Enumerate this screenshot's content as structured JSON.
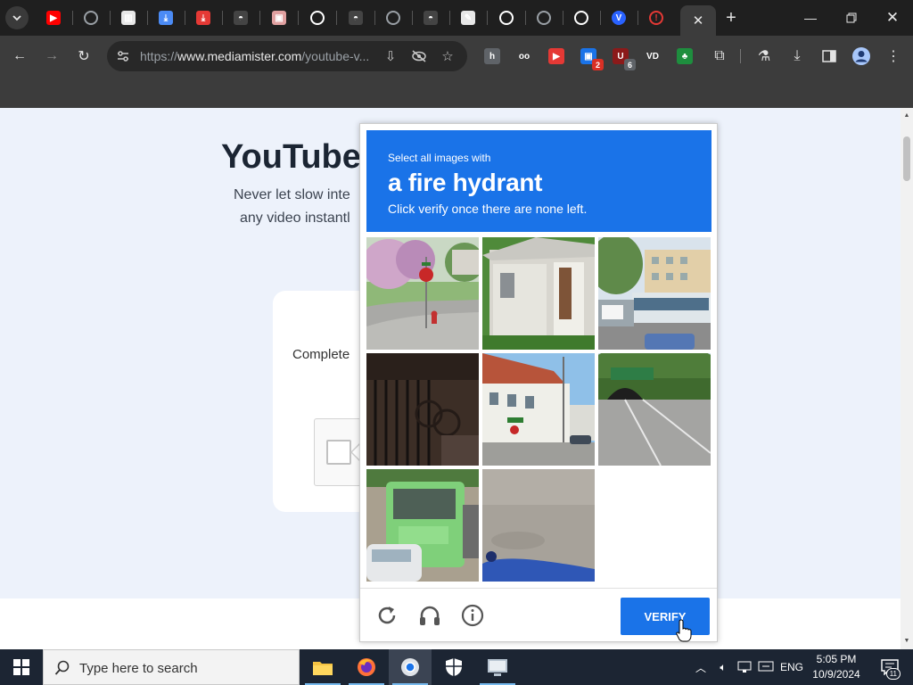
{
  "browser": {
    "tabs": [
      {
        "icon": "youtube-icon",
        "color": "#ff0000"
      },
      {
        "icon": "globe-icon",
        "color": "#9aa0a6"
      },
      {
        "icon": "bank-icon",
        "color": "#e8e8e8"
      },
      {
        "icon": "download-icon",
        "color": "#4b8bf5"
      },
      {
        "icon": "download-red-icon",
        "color": "#e53935"
      },
      {
        "icon": "incognito-icon",
        "color": "#444"
      },
      {
        "icon": "image-icon",
        "color": "#e0a0a0"
      },
      {
        "icon": "globe-icon",
        "color": "#ffffff"
      },
      {
        "icon": "incognito-icon",
        "color": "#444"
      },
      {
        "icon": "globe-icon",
        "color": "#9aa0a6"
      },
      {
        "icon": "incognito-icon",
        "color": "#444"
      },
      {
        "icon": "wrench-icon",
        "color": "#e8e8e8"
      },
      {
        "icon": "globe-icon",
        "color": "#ffffff"
      },
      {
        "icon": "globe-icon",
        "color": "#9aa0a6"
      },
      {
        "icon": "globe-icon",
        "color": "#ffffff"
      },
      {
        "icon": "vd-icon",
        "color": "#2962ff"
      },
      {
        "icon": "warning-icon",
        "color": "#e53935"
      }
    ],
    "url_prefix": "https://",
    "url_domain": "www.mediamister.com",
    "url_path": "/youtube-v...",
    "extensions": [
      {
        "icon": "h-extension-icon",
        "label": "h",
        "color": "#5f6368",
        "badge": ""
      },
      {
        "icon": "glasses-extension-icon",
        "label": "oo",
        "color": "#3c3c3c",
        "badge": ""
      },
      {
        "icon": "red-extension-icon",
        "label": "▶",
        "color": "#e53935",
        "badge": ""
      },
      {
        "icon": "briefcase-extension-icon",
        "label": "▣",
        "color": "#1a73e8",
        "badge": "2"
      },
      {
        "icon": "ublock-extension-icon",
        "label": "U",
        "color": "#8b1a1a",
        "badge": "6"
      },
      {
        "icon": "vd-extension-icon",
        "label": "VD",
        "color": "#3c3c3c",
        "badge": ""
      },
      {
        "icon": "green-extension-icon",
        "label": "♣",
        "color": "#1e8e3e",
        "badge": ""
      }
    ]
  },
  "page": {
    "title": "YouTube",
    "desc_line1": "Never let slow inte",
    "desc_line2": "any video instantl",
    "complete_text": "Complete"
  },
  "captcha": {
    "line1": "Select all images with",
    "target": "a fire hydrant",
    "line3": "Click verify once there are none left.",
    "verify_label": "VERIFY",
    "tiles": [
      "street-corner-stop-sign-hydrant",
      "white-house-porch",
      "city-street-bus",
      "dark-fence-bicycle",
      "street-white-building",
      "highway-tunnel",
      "green-bus",
      "pavement-closeup",
      "empty"
    ]
  },
  "taskbar": {
    "search_placeholder": "Type here to search",
    "language": "ENG",
    "time": "5:05 PM",
    "date": "10/9/2024",
    "notification_count": "11"
  },
  "colors": {
    "captcha_blue": "#1a73e8",
    "page_bg": "#edf2fb",
    "browser_dark": "#3c3c3c"
  }
}
